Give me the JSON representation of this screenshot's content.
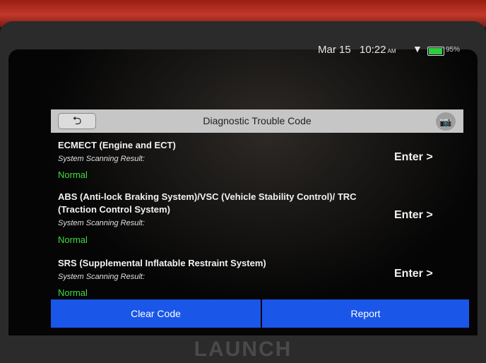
{
  "status_bar": {
    "date": "Mar 15",
    "time": "10:22",
    "ampm": "AM",
    "wifi_icon": "wifi-icon",
    "battery_percent": "95%",
    "battery_level": 0.95,
    "battery_color": "#2ecc40"
  },
  "header": {
    "back_icon": "back-arrow-icon",
    "back_glyph": "⮌",
    "title": "Diagnostic Trouble Code",
    "camera_icon": "camera-icon",
    "camera_glyph": "📷"
  },
  "systems": [
    {
      "name": "ECMECT (Engine and ECT)",
      "label": "System Scanning Result:",
      "status": "Normal",
      "action": "Enter >"
    },
    {
      "name": "ABS (Anti-lock Braking System)/VSC (Vehicle Stability Control)/ TRC (Traction Control System)",
      "label": "System Scanning Result:",
      "status": "Normal",
      "action": "Enter >"
    },
    {
      "name": "SRS (Supplemental Inflatable Restraint System)",
      "label": "System Scanning Result:",
      "status": "Normal",
      "action": "Enter >"
    }
  ],
  "footer": {
    "clear_code": "Clear Code",
    "report": "Report",
    "button_color": "#1a56e8"
  },
  "device": {
    "brand": "LAUNCH",
    "housing_color": "#c0392b"
  }
}
